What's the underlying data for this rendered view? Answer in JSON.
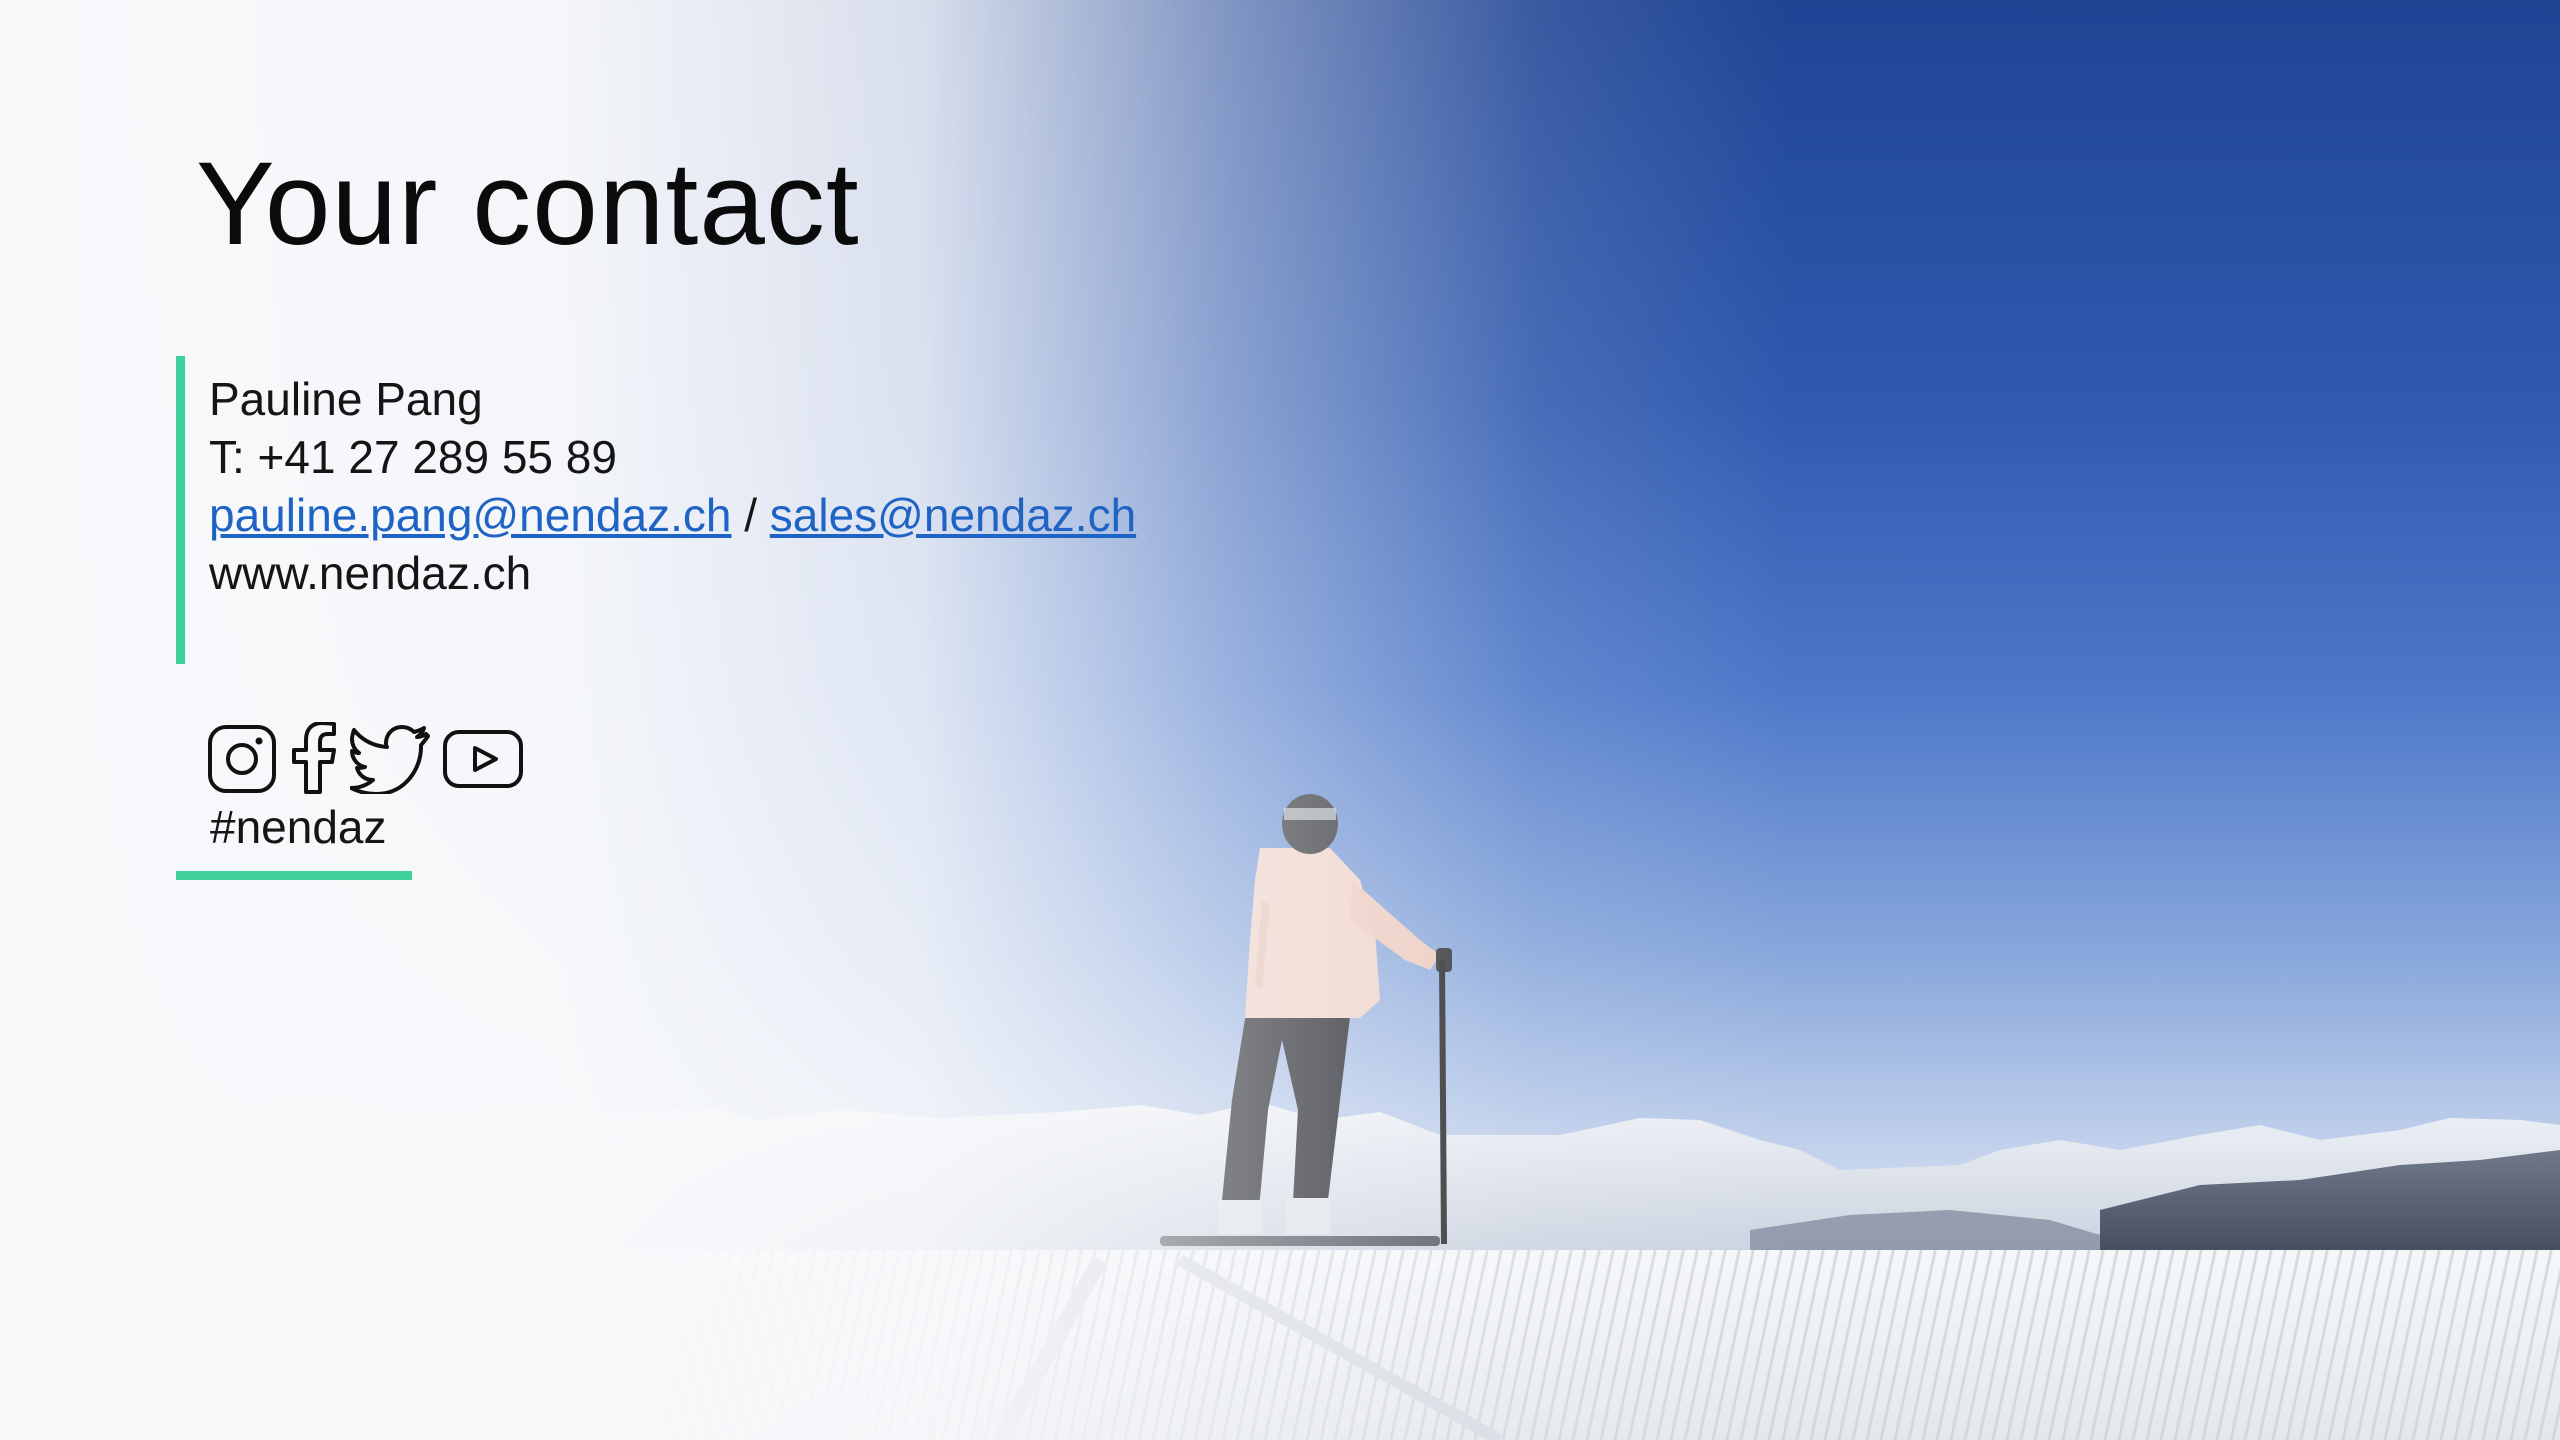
{
  "slide": {
    "title": "Your contact",
    "contact": {
      "name": "Pauline Pang",
      "phone": "T: +41 27 289 55 89",
      "email_primary": "pauline.pang@nendaz.ch",
      "email_separator": "/",
      "email_secondary": "sales@nendaz.ch",
      "website": "www.nendaz.ch"
    },
    "social": {
      "icons": [
        "instagram-icon",
        "facebook-icon",
        "twitter-icon",
        "youtube-icon"
      ],
      "hashtag": "#nendaz"
    }
  },
  "colors": {
    "accent": "#3ecf9a",
    "link": "#1f63c4",
    "text": "#151515",
    "sky_top": "#1f4494"
  }
}
